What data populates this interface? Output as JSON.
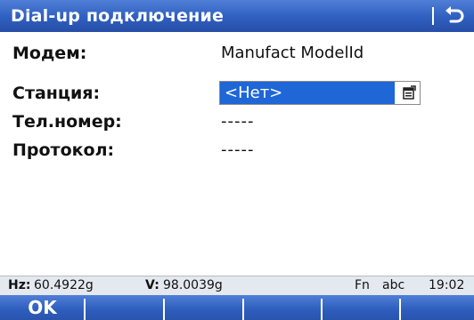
{
  "title_bar": {
    "title": "Dial-up подключение",
    "back_icon": "back-arrow-icon"
  },
  "fields": {
    "modem": {
      "label": "Модем:",
      "value": "Manufact ModelId"
    },
    "station": {
      "label": "Станция:",
      "value": "<Нет>",
      "dropdown_icon": "dropdown-list-icon"
    },
    "phone": {
      "label": "Тел.номер:",
      "value": "-----"
    },
    "protocol": {
      "label": "Протокол:",
      "value": "-----"
    }
  },
  "status_bar": {
    "hz_label": "Hz:",
    "hz_value": "60.4922g",
    "v_label": "V:",
    "v_value": "98.0039g",
    "fn": "Fn",
    "input_mode": "abc",
    "time": "19:02"
  },
  "softkeys": {
    "f1": "OK",
    "f2": "",
    "f3": "",
    "f4": "",
    "f5": "",
    "f6": ""
  },
  "colors": {
    "title_bar": "#2f5fbf",
    "selection": "#1f66d6",
    "status_bar": "#e4e8ef"
  }
}
